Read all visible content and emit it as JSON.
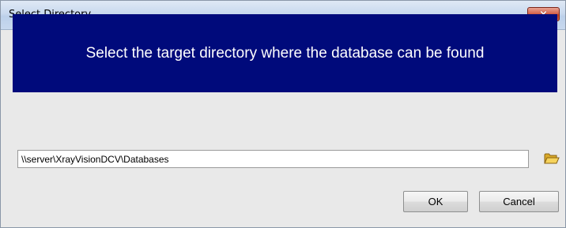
{
  "window": {
    "title": "Select Directory",
    "close_label": "×"
  },
  "banner": {
    "message": "Select the target directory where the database can be found",
    "color": "#000a7b"
  },
  "path": {
    "value": "\\\\server\\XrayVisionDCV\\Databases"
  },
  "icons": {
    "close": "close-icon",
    "browse": "folder-icon"
  },
  "buttons": {
    "ok_label": "OK",
    "cancel_label": "Cancel"
  }
}
